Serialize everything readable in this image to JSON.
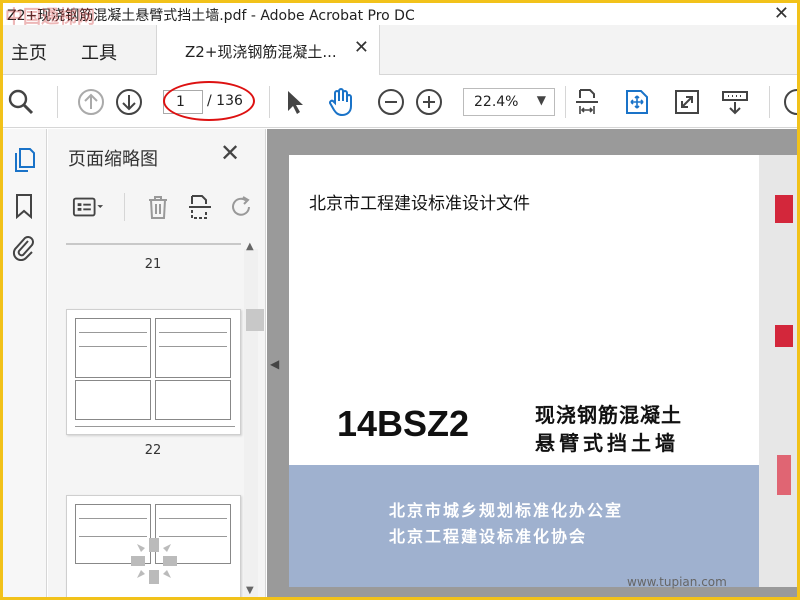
{
  "window": {
    "title": "Z2+现浇钢筋混凝土悬臂式挡土墙.pdf - Adobe Acrobat Pro DC",
    "watermark": "中国通梯网"
  },
  "menu": {
    "home": "主页",
    "tools": "工具"
  },
  "tab": {
    "label": "Z2+现浇钢筋混凝土..."
  },
  "toolbar": {
    "page_current": "1",
    "page_total": "/ 136",
    "zoom": "22.4%"
  },
  "panel": {
    "title": "页面缩略图",
    "thumbnails": [
      {
        "label": "21"
      },
      {
        "label": "22"
      }
    ]
  },
  "document": {
    "header": "北京市工程建设标准设计文件",
    "code": "14BSZ2",
    "name_line1": "现浇钢筋混凝土",
    "name_line2": "悬臂式挡土墙",
    "org_line1": "北京市城乡规划标准化办公室",
    "org_line2": "北京工程建设标准化协会",
    "site_watermark": "www.tupian.com"
  },
  "colors": {
    "frame_border": "#f2c21a",
    "accent_blue": "#1a73c8",
    "annotation_red": "#d11111",
    "cover_band": "#9fb1cf"
  }
}
